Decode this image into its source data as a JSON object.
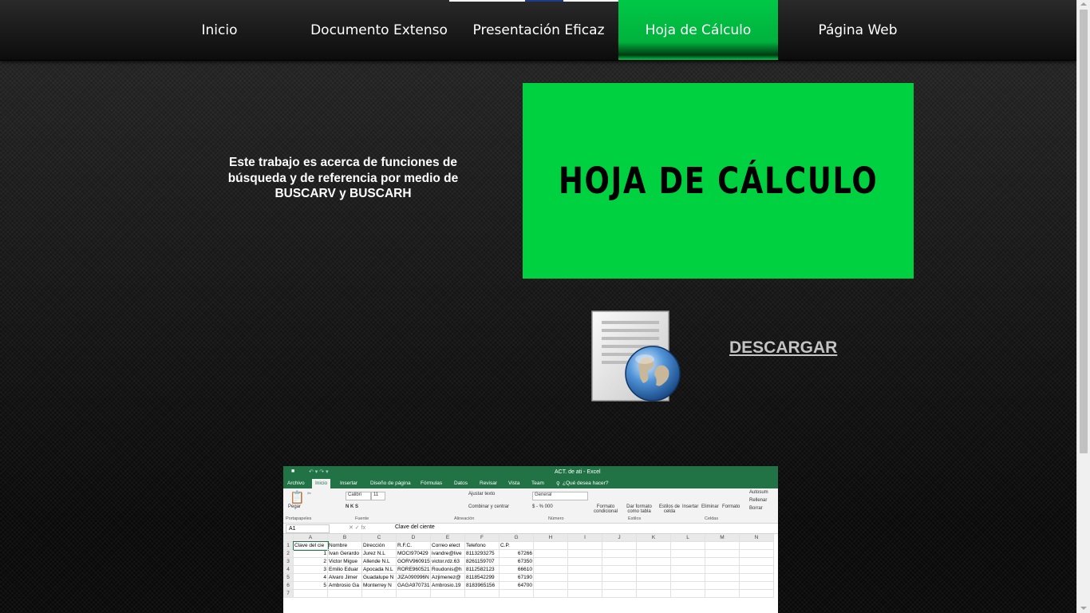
{
  "nav": {
    "items": [
      {
        "label": "Inicio",
        "active": false
      },
      {
        "label": "Documento Extenso",
        "active": false
      },
      {
        "label": "Presentación Eficaz",
        "active": false
      },
      {
        "label": "Hoja de Cálculo",
        "active": true
      },
      {
        "label": "Página Web",
        "active": false
      }
    ]
  },
  "intro": {
    "text": "Este trabajo es acerca de funciones de búsqueda y de referencia por medio de BUSCARV y BUSCARH"
  },
  "banner": {
    "title": "HOJA DE CÁLCULO"
  },
  "download": {
    "label": "DESCARGAR"
  },
  "colors": {
    "accent_green": "#00d140",
    "excel_green": "#217346"
  },
  "icons": {
    "document": "document-globe-icon"
  },
  "excel": {
    "title": "ACT. de ati - Excel",
    "tabs": [
      "Archivo",
      "Inicio",
      "Insertar",
      "Diseño de página",
      "Fórmulas",
      "Datos",
      "Revisar",
      "Vista",
      "Team"
    ],
    "tell_me": "¿Qué desea hacer?",
    "ribbon": {
      "paste": "Pegar",
      "font": "Calibri",
      "font_size": "11",
      "wrap": "Ajustar texto",
      "merge": "Combinar y centrar",
      "number_format": "General",
      "cond_format": "Formato condicional",
      "table_format": "Dar formato como tabla",
      "cell_styles": "Estilos de celda",
      "insert": "Insertar",
      "delete": "Eliminar",
      "format": "Formato",
      "autosum": "Autosum",
      "fill": "Rellenar",
      "clear": "Borrar"
    },
    "groups": [
      "Portapapeles",
      "Fuente",
      "Alineación",
      "Número",
      "Estilos",
      "Celdas"
    ],
    "name_box": "A1",
    "formula": "Clave del ciente",
    "columns": [
      "A",
      "B",
      "C",
      "D",
      "E",
      "F",
      "G",
      "H",
      "I",
      "J",
      "K",
      "L",
      "M",
      "N"
    ],
    "rows": [
      [
        "Clave del cie",
        "Nombre",
        "Dirección",
        "R.F.C.",
        "Correo elect",
        "Telefono",
        "C.P."
      ],
      [
        "1",
        "Ivan Gerardo",
        "Jurez N.L",
        "MOCI970429",
        "ivandre@live",
        "8113293275",
        "67266"
      ],
      [
        "2",
        "Victor Migue",
        "Allende N.L",
        "GORV960915",
        "victor.rdz.63",
        "8261159707",
        "67350"
      ],
      [
        "3",
        "Emilio Eduar",
        "Apocada N.L",
        "RORE960521",
        "Roudonis@h",
        "8112582123",
        "66610"
      ],
      [
        "4",
        "Alvaro Jimer",
        "Guadalupe N",
        "JIZA090996N",
        "Azjimenez@",
        "8118542299",
        "67190"
      ],
      [
        "5",
        "Ambrosio Ga",
        "Monterrey N",
        "GAGA970731",
        "Ambrosio.19",
        "8183965156",
        "64700"
      ],
      [
        "",
        "",
        "",
        "",
        "",
        "",
        ""
      ]
    ]
  }
}
